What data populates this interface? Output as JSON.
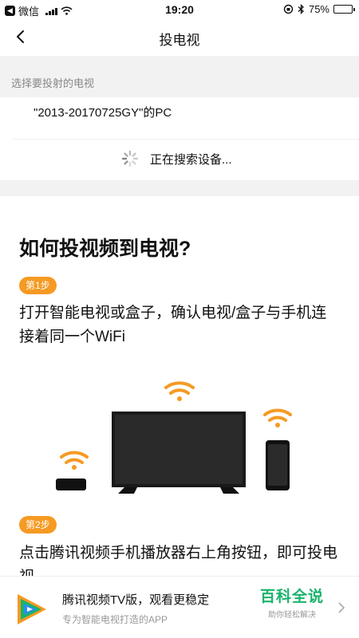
{
  "status_bar": {
    "carrier": "微信",
    "time": "19:20",
    "battery": "75%",
    "battery_level": 0.75
  },
  "nav": {
    "title": "投电视"
  },
  "select_section": {
    "header": "选择要投射的电视",
    "device_name": "\"2013-20170725GY\"的PC",
    "searching_text": "正在搜索设备..."
  },
  "guide": {
    "title": "如何投视频到电视?",
    "steps": [
      {
        "badge": "第1步",
        "text": "打开智能电视或盒子，确认电视/盒子与手机连接着同一个WiFi"
      },
      {
        "badge": "第2步",
        "text": "点击腾讯视频手机播放器右上角按钮，即可投电视"
      }
    ]
  },
  "ad": {
    "title": "腾讯视频TV版，观看更稳定",
    "subtitle": "专为智能电视打造的APP",
    "brand": "百科全说",
    "brand_sub": "助你轻松解决"
  },
  "colors": {
    "accent": "#f59a23",
    "brand_green": "#19b36b"
  }
}
